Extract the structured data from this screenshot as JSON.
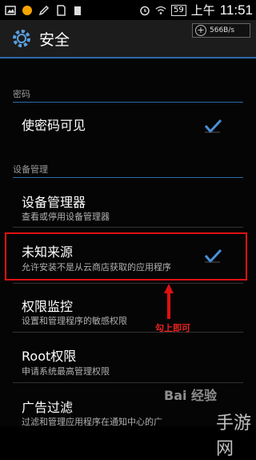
{
  "status_bar": {
    "carrier": "上午",
    "time": "11:51",
    "battery": "59"
  },
  "action_bar": {
    "title": "安全",
    "speed": "566B/s"
  },
  "sections": [
    {
      "label": "密码"
    },
    {
      "label": "设备管理"
    }
  ],
  "items": [
    {
      "title": "使密码可见",
      "subtitle": "",
      "checked": true
    },
    {
      "title": "设备管理器",
      "subtitle": "查看或停用设备管理器",
      "checked": false
    },
    {
      "title": "未知来源",
      "subtitle": "允许安装不是从云商店获取的应用程序",
      "checked": true
    },
    {
      "title": "权限监控",
      "subtitle": "设置和管理程序的敏感权限",
      "checked": false
    },
    {
      "title": "Root权限",
      "subtitle": "申请系统最高管理权限",
      "checked": false
    },
    {
      "title": "广告过滤",
      "subtitle": "过滤和管理应用程序在通知中心的广",
      "checked": false
    }
  ],
  "annotation": "勾上即可",
  "watermark": "Bai 经验",
  "watermark2": "手游网",
  "colors": {
    "accent": "#2d6aa8",
    "highlight": "#dd1111"
  }
}
